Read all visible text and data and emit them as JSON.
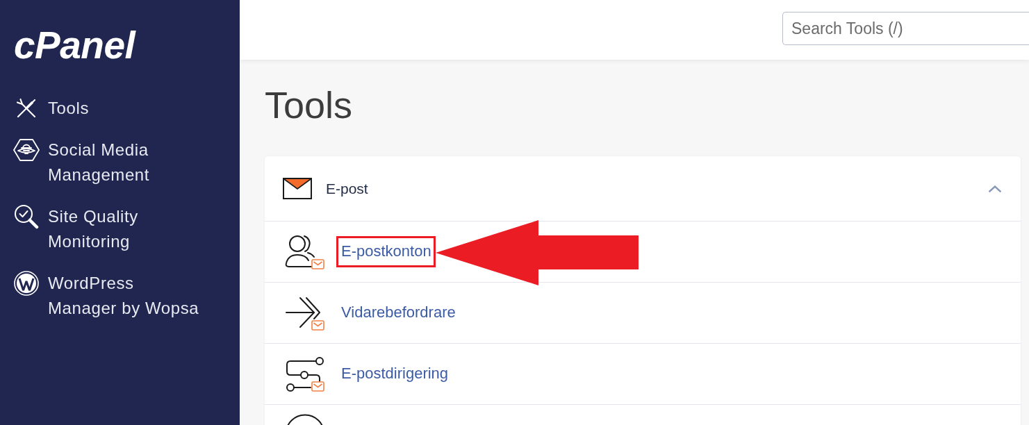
{
  "sidebar": {
    "logo": "cPanel",
    "items": [
      {
        "kind": "tools",
        "label": "Tools"
      },
      {
        "kind": "social",
        "label": "Social Media Management"
      },
      {
        "kind": "quality",
        "label": "Site Quality Monitoring"
      },
      {
        "kind": "wordpress",
        "label": "WordPress Manager by Wopsa"
      }
    ]
  },
  "search": {
    "placeholder": "Search Tools (/)"
  },
  "page_title": "Tools",
  "section": {
    "title": "E-post",
    "expanded": true,
    "items": [
      {
        "kind": "account",
        "label": "E-postkonton",
        "highlighted": true
      },
      {
        "kind": "forwarder",
        "label": "Vidarebefordrare",
        "highlighted": false
      },
      {
        "kind": "routing",
        "label": "E-postdirigering",
        "highlighted": false
      },
      {
        "kind": "circle"
      }
    ]
  }
}
